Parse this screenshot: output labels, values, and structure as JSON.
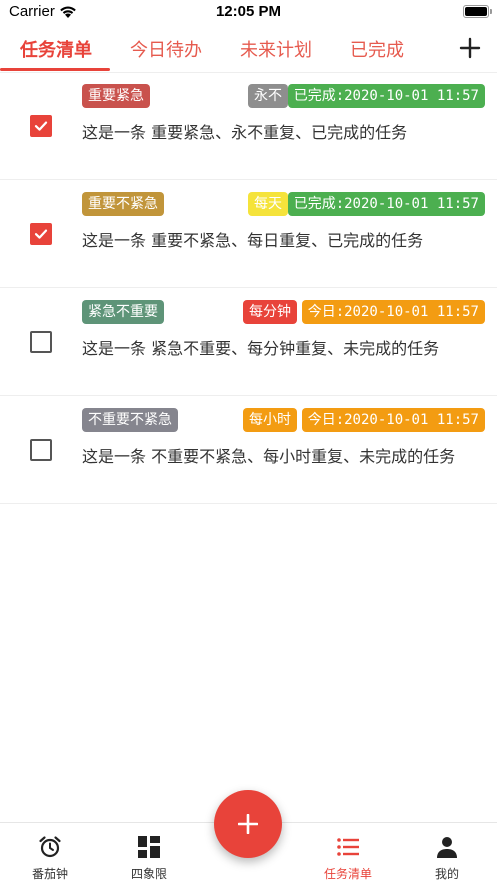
{
  "status_bar": {
    "carrier": "Carrier",
    "time": "12:05 PM"
  },
  "tabs": [
    {
      "label": "任务清单",
      "active": true
    },
    {
      "label": "今日待办",
      "active": false
    },
    {
      "label": "未来计划",
      "active": false
    },
    {
      "label": "已完成",
      "active": false
    }
  ],
  "tasks": [
    {
      "checked": true,
      "priority": "重要紧急",
      "priority_color": "#c9524d",
      "repeat": "永不",
      "repeat_color": "#8e8e8e",
      "date": "已完成:2020-10-01 11:57",
      "date_color": "#4caf50",
      "title": "这是一条  重要紧急、永不重复、已完成的任务"
    },
    {
      "checked": true,
      "priority": "重要不紧急",
      "priority_color": "#c1953a",
      "repeat": "每天",
      "repeat_color": "#f5e33b",
      "date": "已完成:2020-10-01 11:57",
      "date_color": "#4caf50",
      "title": "这是一条  重要不紧急、每日重复、已完成的任务"
    },
    {
      "checked": false,
      "priority": "紧急不重要",
      "priority_color": "#5e9478",
      "repeat": "每分钟",
      "repeat_color": "#e8433a",
      "date": "今日:2020-10-01 11:57",
      "date_color": "#f39c12",
      "title": "这是一条  紧急不重要、每分钟重复、未完成的任务"
    },
    {
      "checked": false,
      "priority": "不重要不紧急",
      "priority_color": "#85858e",
      "repeat": "每小时",
      "repeat_color": "#f39c12",
      "date": "今日:2020-10-01 11:57",
      "date_color": "#f39c12",
      "title": "这是一条  不重要不紧急、每小时重复、未完成的任务"
    }
  ],
  "bottom_nav": [
    {
      "label": "番茄钟",
      "icon": "alarm-clock-icon",
      "active": false
    },
    {
      "label": "四象限",
      "icon": "quadrant-icon",
      "active": false
    },
    {
      "label": "任务清单",
      "icon": "list-icon",
      "active": true
    },
    {
      "label": "我的",
      "icon": "person-icon",
      "active": false
    }
  ],
  "colors": {
    "accent": "#e8433a"
  }
}
